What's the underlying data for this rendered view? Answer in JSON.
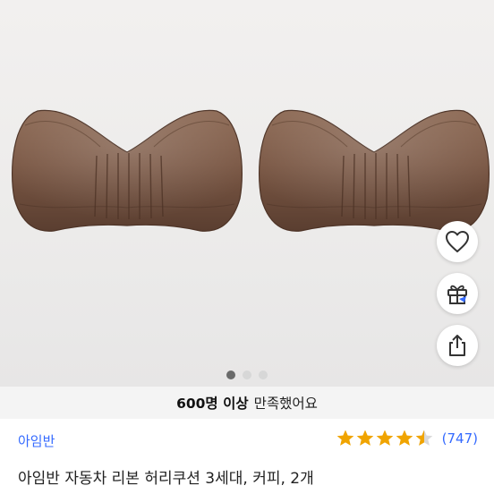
{
  "product": {
    "image_alt": "아임반 자동차 리본 허리쿠션 3세대, 커피, 2개",
    "carousel": {
      "total": 3,
      "active_index": 0
    }
  },
  "actions": [
    {
      "name": "wishlist",
      "icon": "heart-icon"
    },
    {
      "name": "gift",
      "icon": "gift-icon"
    },
    {
      "name": "share",
      "icon": "share-icon"
    }
  ],
  "satisfaction": {
    "count_text": "600명 이상",
    "text": "만족했어요"
  },
  "brand": "아임반",
  "rating": {
    "stars": 4.5,
    "max": 5,
    "review_count": "(747)"
  },
  "title": "아임반 자동차 리본 허리쿠션 3세대, 커피, 2개",
  "colors": {
    "link_blue": "#346aff",
    "star_gold": "#f0a400",
    "cushion_brown": "#7d5a46"
  }
}
